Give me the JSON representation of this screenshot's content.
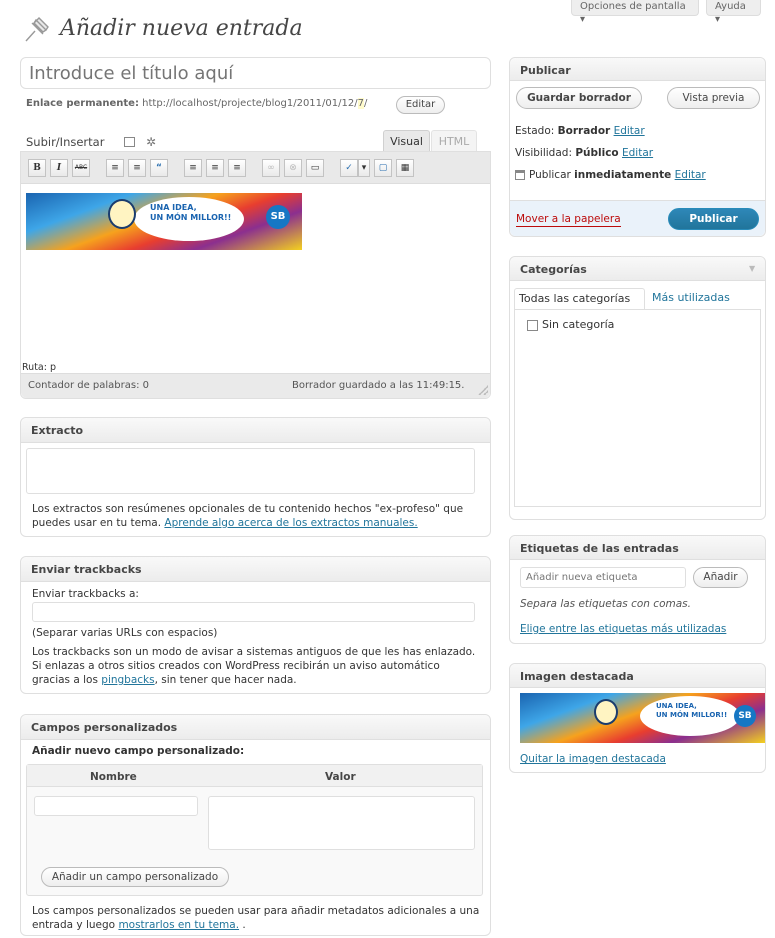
{
  "header": {
    "screen_options": "Opciones de pantalla ▾",
    "help": "Ayuda ▾",
    "title": "Añadir nueva entrada",
    "title_placeholder": "Introduce el título aquí",
    "permalink_label": "Enlace permanente:",
    "permalink_url": "http://localhost/projecte/blog1/2011/01/12/",
    "permalink_slug": "7",
    "permalink_end": "/",
    "edit_button": "Editar"
  },
  "editor": {
    "upload_label": "Subir/Insertar",
    "tab_visual": "Visual",
    "tab_html": "HTML",
    "path": "Ruta: p",
    "word_count": "Contador de palabras: 0",
    "draft_saved": "Borrador guardado a las 11:49:15.",
    "banner_text_1": "UNA IDEA,",
    "banner_text_2": "UN MÓN MILLOR!!",
    "banner_logo": "SB",
    "toolbar": [
      "B",
      "I",
      "ABC",
      "≡",
      "≡",
      "“",
      "≡",
      "≡",
      "≡",
      "∞",
      "⊗",
      "▭",
      "✓",
      "▾",
      "▢",
      "▦"
    ]
  },
  "excerpt": {
    "title": "Extracto",
    "help_1": "Los extractos son resúmenes opcionales de tu contenido hechos \"ex-profeso\" que",
    "help_2": "puedes usar en tu tema.",
    "help_link": "Aprende algo acerca de los extractos manuales."
  },
  "trackbacks": {
    "title": "Enviar trackbacks",
    "label": "Enviar trackbacks a:",
    "hint": "(Separar varias URLs con espacios)",
    "help_1": "Los trackbacks son un modo de avisar a sistemas antiguos de que les has enlazado.",
    "help_2": "Si enlazas a otros sitios creados con WordPress recibirán un aviso automático",
    "help_3": "gracias a los",
    "help_link": "pingbacks",
    "help_4": ", sin tener que hacer nada."
  },
  "custom_fields": {
    "title": "Campos personalizados",
    "add_new_label": "Añadir nuevo campo personalizado:",
    "col_name": "Nombre",
    "col_value": "Valor",
    "add_button": "Añadir un campo personalizado",
    "help_1": "Los campos personalizados se pueden usar para añadir metadatos adicionales a una",
    "help_2": "entrada y luego",
    "help_link": "mostrarlos en tu tema.",
    "help_3": "."
  },
  "publish": {
    "title": "Publicar",
    "save_draft": "Guardar borrador",
    "preview": "Vista previa",
    "status_label": "Estado:",
    "status_value": "Borrador",
    "visibility_label": "Visibilidad:",
    "visibility_value": "Público",
    "publish_label": "Publicar",
    "publish_value": "inmediatamente",
    "edit_link": "Editar",
    "trash_link": "Mover a la papelera",
    "publish_button": "Publicar"
  },
  "categories": {
    "title": "Categorías",
    "tab_all": "Todas las categorías",
    "tab_popular": "Más utilizadas",
    "items": [
      "Sin categoría"
    ]
  },
  "tags": {
    "title": "Etiquetas de las entradas",
    "input_placeholder": "Añadir nueva etiqueta",
    "add_button": "Añadir",
    "hint": "Separa las etiquetas con comas.",
    "choose_link": "Elige entre las etiquetas más utilizadas"
  },
  "featured": {
    "title": "Imagen destacada",
    "remove_link": "Quitar la imagen destacada"
  },
  "colors": {
    "link": "#21759b",
    "trash": "#bc0b0b",
    "primary_button": "#21759b",
    "slug_highlight": "#fffbcc"
  }
}
